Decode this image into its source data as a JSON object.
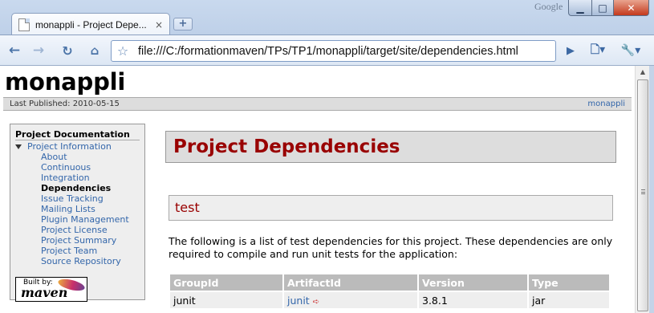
{
  "browser": {
    "tab_title": "monappli - Project Depe...",
    "tab_close": "×",
    "new_tab": "+",
    "google_label": "Google",
    "window_controls": {
      "minimize": "▁",
      "maximize": "□",
      "close": "✕"
    },
    "nav": {
      "back": "←",
      "forward": "→",
      "reload": "↻",
      "home": "⌂",
      "star": "☆",
      "go": "▶",
      "page_menu": "🗋▾",
      "tools_menu": "🔧▾"
    },
    "url": "file:///C:/formationmaven/TPs/TP1/monappli/target/site/dependencies.html"
  },
  "site": {
    "banner": "monappli",
    "published": "Last Published: 2010-05-15",
    "breadcrumb_right": "monappli"
  },
  "sidebar": {
    "heading": "Project Documentation",
    "group": "Project Information",
    "items": [
      {
        "label": "About"
      },
      {
        "label": "Continuous"
      },
      {
        "label": "Integration"
      },
      {
        "label": "Dependencies"
      },
      {
        "label": "Issue Tracking"
      },
      {
        "label": "Mailing Lists"
      },
      {
        "label": "Plugin Management"
      },
      {
        "label": "Project License"
      },
      {
        "label": "Project Summary"
      },
      {
        "label": "Project Team"
      },
      {
        "label": "Source Repository"
      }
    ],
    "current_item": "Dependencies",
    "powered_by": "Built by:",
    "maven_logo": "maven"
  },
  "main": {
    "title": "Project Dependencies",
    "subtitle": "test",
    "description": "The following is a list of test dependencies for this project. These dependencies are only required to compile and run unit tests for the application:",
    "table": {
      "headers": [
        "GroupId",
        "ArtifactId",
        "Version",
        "Type"
      ],
      "rows": [
        [
          "junit",
          "junit",
          "3.8.1",
          "jar"
        ]
      ]
    }
  },
  "colors": {
    "heading_red": "#990000",
    "link_blue": "#3366aa",
    "chrome_blue": "#c9d9ee"
  }
}
